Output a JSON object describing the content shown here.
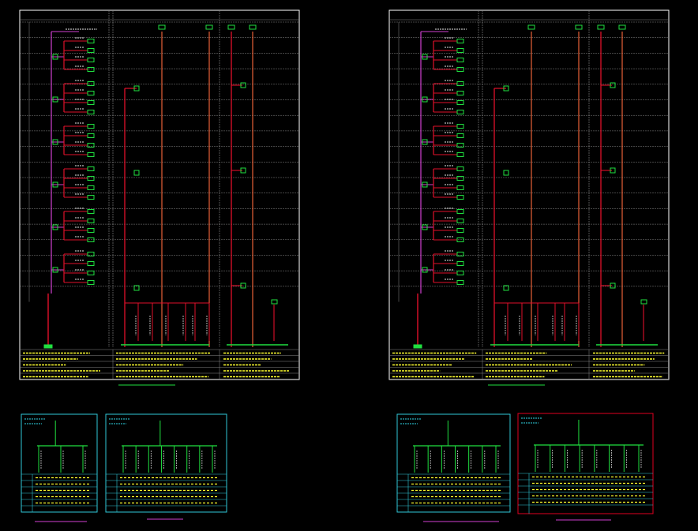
{
  "drawing": {
    "background": "#000000",
    "colors": {
      "frame": "#ffffff",
      "grid": "#8a8a8a",
      "riser_red": "#e0102a",
      "riser_orange": "#ff6a3c",
      "magenta": "#d040d0",
      "panel_green": "#20e040",
      "text_yellow": "#ffff30",
      "text_white": "#e8e8e8",
      "text_cyan": "#30d8e8",
      "frame_cyan": "#30c8d8",
      "frame_red": "#e00020"
    },
    "note": ""
  },
  "sheet_left": {
    "column_headers": [
      "",
      "",
      ""
    ],
    "floor_labels": [
      "",
      "",
      "",
      "",
      "",
      "",
      "",
      "",
      "",
      "",
      "",
      "",
      "",
      "",
      "",
      "",
      ""
    ],
    "title": ""
  },
  "sheet_right": {
    "column_headers": [
      "",
      "",
      ""
    ],
    "floor_labels": [
      "",
      "",
      "",
      "",
      "",
      "",
      "",
      "",
      "",
      "",
      "",
      "",
      "",
      "",
      "",
      "",
      ""
    ],
    "title": ""
  },
  "small_diagrams": [
    {
      "title": ""
    },
    {
      "title": ""
    },
    {
      "title": ""
    },
    {
      "title": ""
    }
  ]
}
